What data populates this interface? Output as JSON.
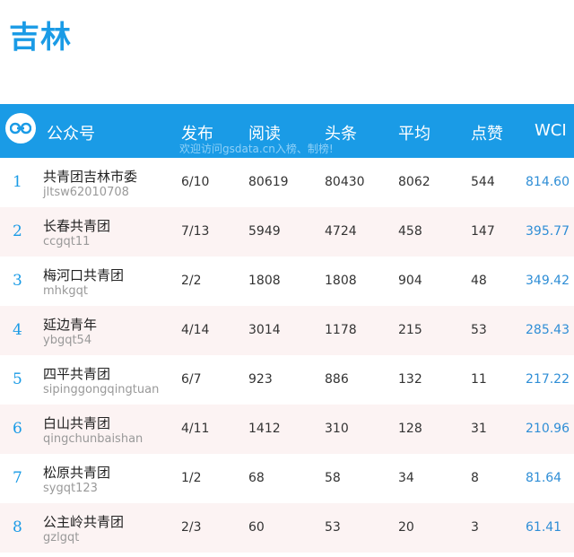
{
  "page_title": "吉林",
  "header": {
    "account_label": "公众号",
    "publish_label": "发布",
    "reads_label": "阅读",
    "headline_label": "头条",
    "average_label": "平均",
    "likes_label": "点赞",
    "wci_label": "WCI",
    "watermark": "欢迎访问gsdata.cn入榜、制榜!"
  },
  "rows": [
    {
      "rank": "1",
      "name": "共青团吉林市委",
      "account": "jltsw62010708",
      "publish": "6/10",
      "reads": "80619",
      "headline": "80430",
      "average": "8062",
      "likes": "544",
      "wci": "814.60"
    },
    {
      "rank": "2",
      "name": "长春共青团",
      "account": "ccgqt11",
      "publish": "7/13",
      "reads": "5949",
      "headline": "4724",
      "average": "458",
      "likes": "147",
      "wci": "395.77"
    },
    {
      "rank": "3",
      "name": "梅河口共青团",
      "account": "mhkgqt",
      "publish": "2/2",
      "reads": "1808",
      "headline": "1808",
      "average": "904",
      "likes": "48",
      "wci": "349.42"
    },
    {
      "rank": "4",
      "name": "延边青年",
      "account": "ybgqt54",
      "publish": "4/14",
      "reads": "3014",
      "headline": "1178",
      "average": "215",
      "likes": "53",
      "wci": "285.43"
    },
    {
      "rank": "5",
      "name": "四平共青团",
      "account": "sipinggongqingtuan",
      "publish": "6/7",
      "reads": "923",
      "headline": "886",
      "average": "132",
      "likes": "11",
      "wci": "217.22"
    },
    {
      "rank": "6",
      "name": "白山共青团",
      "account": "qingchunbaishan",
      "publish": "4/11",
      "reads": "1412",
      "headline": "310",
      "average": "128",
      "likes": "31",
      "wci": "210.96"
    },
    {
      "rank": "7",
      "name": "松原共青团",
      "account": "sygqt123",
      "publish": "1/2",
      "reads": "68",
      "headline": "58",
      "average": "34",
      "likes": "8",
      "wci": "81.64"
    },
    {
      "rank": "8",
      "name": "公主岭共青团",
      "account": "gzlgqt",
      "publish": "2/3",
      "reads": "60",
      "headline": "53",
      "average": "20",
      "likes": "3",
      "wci": "61.41"
    }
  ]
}
